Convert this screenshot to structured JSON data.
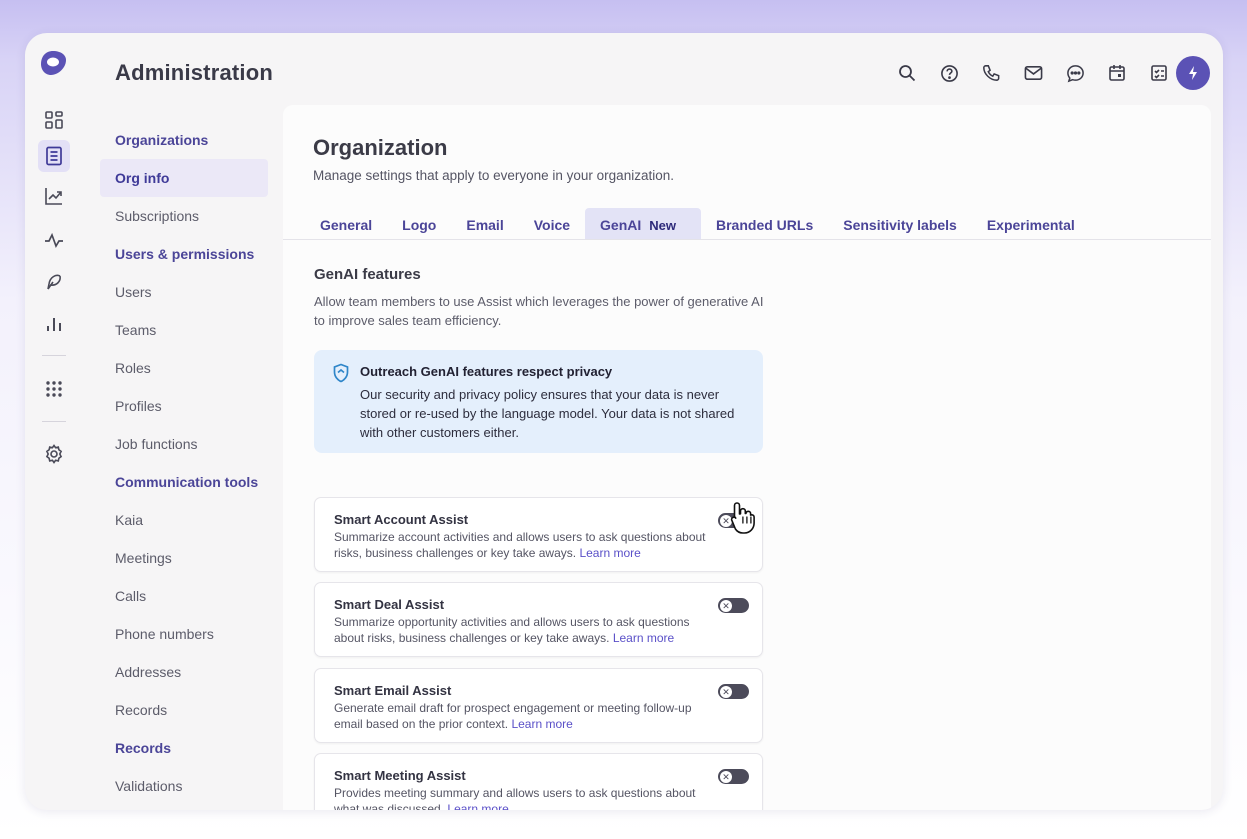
{
  "app": {
    "title": "Administration"
  },
  "header": {
    "icons": [
      "search-icon",
      "help-icon",
      "phone-icon",
      "mail-icon",
      "chat-icon",
      "calendar-icon",
      "tasks-icon"
    ],
    "action_icon": "bolt-icon"
  },
  "rail": {
    "icons": [
      "dashboard-icon",
      "document-icon",
      "trending-icon",
      "activity-icon",
      "feather-icon",
      "bar-chart-icon",
      "apps-grid-icon",
      "settings-icon"
    ]
  },
  "subnav": {
    "items": [
      {
        "label": "Organizations",
        "type": "section"
      },
      {
        "label": "Org info",
        "type": "active"
      },
      {
        "label": "Subscriptions",
        "type": "item"
      },
      {
        "label": "Users & permissions",
        "type": "section"
      },
      {
        "label": "Users",
        "type": "item"
      },
      {
        "label": "Teams",
        "type": "item"
      },
      {
        "label": "Roles",
        "type": "item"
      },
      {
        "label": "Profiles",
        "type": "item"
      },
      {
        "label": "Job functions",
        "type": "item"
      },
      {
        "label": "Communication tools",
        "type": "section"
      },
      {
        "label": "Kaia",
        "type": "item"
      },
      {
        "label": "Meetings",
        "type": "item"
      },
      {
        "label": "Calls",
        "type": "item"
      },
      {
        "label": "Phone numbers",
        "type": "item"
      },
      {
        "label": "Addresses",
        "type": "item"
      },
      {
        "label": "Records",
        "type": "item"
      },
      {
        "label": "Records",
        "type": "section"
      },
      {
        "label": "Validations",
        "type": "item"
      }
    ]
  },
  "main": {
    "title": "Organization",
    "subtitle": "Manage settings that apply to everyone in your organization.",
    "tabs": [
      {
        "label": "General"
      },
      {
        "label": "Logo"
      },
      {
        "label": "Email"
      },
      {
        "label": "Voice"
      },
      {
        "label": "GenAI",
        "badge": "New",
        "active": true
      },
      {
        "label": "Branded URLs"
      },
      {
        "label": "Sensitivity labels"
      },
      {
        "label": "Experimental"
      }
    ],
    "section_title": "GenAI features",
    "section_desc": "Allow team members to use Assist which leverages the power of generative AI to improve sales team efficiency.",
    "notice": {
      "title": "Outreach GenAI features respect privacy",
      "text": "Our security and privacy policy ensures that your data is never stored or re-used by the language model. Your data is not shared with other customers either."
    },
    "features": [
      {
        "title": "Smart Account Assist",
        "desc": "Summarize account activities and allows users to ask questions about risks, business challenges or key take aways.",
        "link": "Learn more",
        "enabled": false
      },
      {
        "title": "Smart Deal Assist",
        "desc": "Summarize opportunity activities and allows users to ask questions about risks, business challenges or key take aways.",
        "link": "Learn more",
        "enabled": false
      },
      {
        "title": "Smart Email Assist",
        "desc": "Generate email draft for prospect engagement or meeting follow-up email based on the prior context.",
        "link": "Learn more",
        "enabled": false
      },
      {
        "title": "Smart Meeting Assist",
        "desc": "Provides meeting summary and allows users to ask questions about what was discussed.",
        "link": "Learn more",
        "enabled": false
      }
    ]
  },
  "colors": {
    "accent": "#4b4598",
    "brand": "#5b52b5",
    "link": "#5a50c8",
    "notice_bg": "#e4effc",
    "toggle_off": "#4c4b5a"
  }
}
